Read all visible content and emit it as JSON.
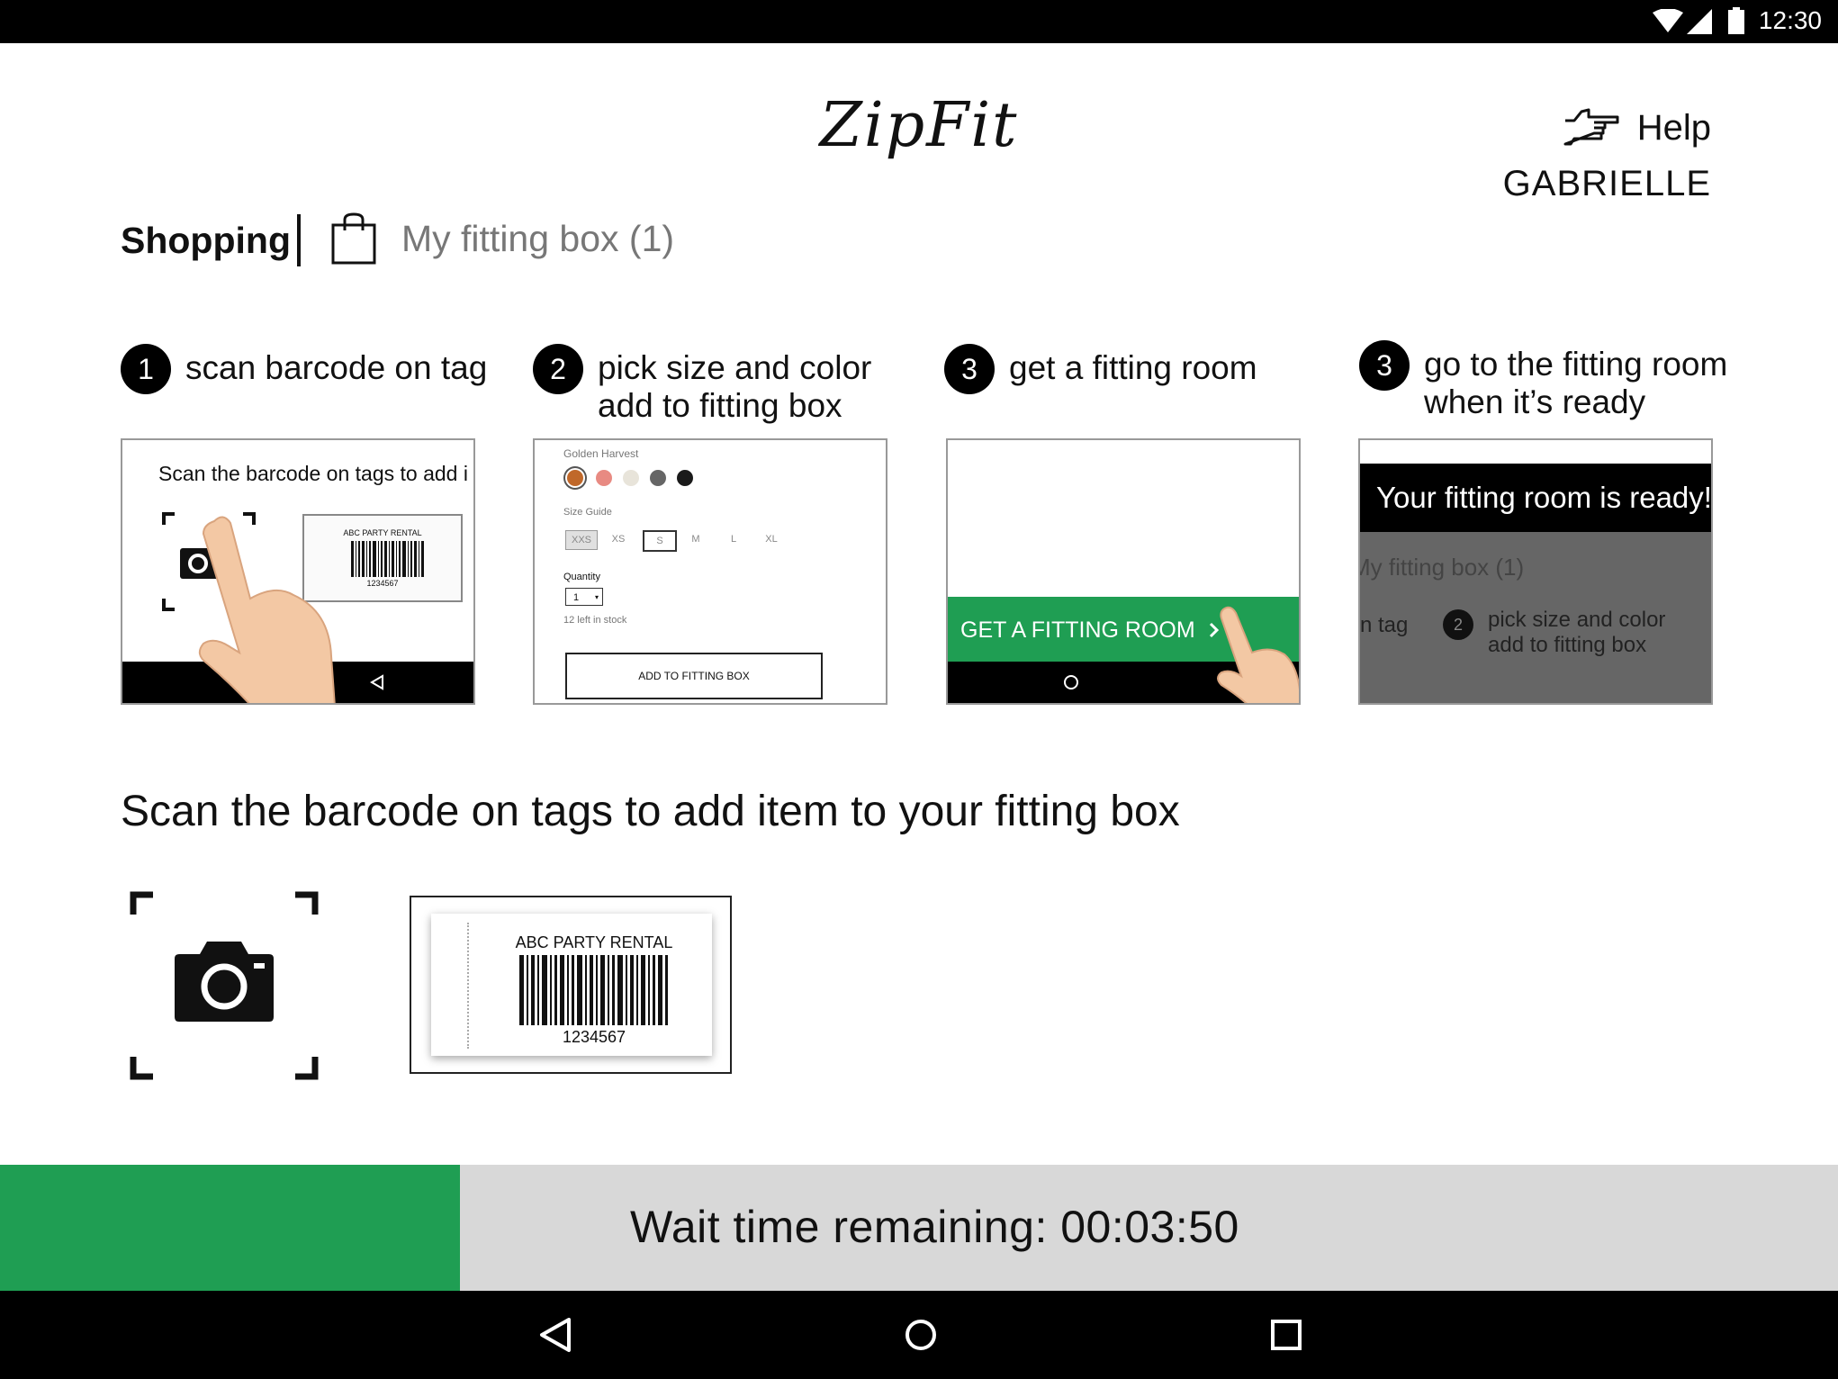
{
  "status_bar": {
    "time": "12:30"
  },
  "header": {
    "logo": "ZipFit",
    "help_label": "Help",
    "user_name": "GABRIELLE"
  },
  "tabs": {
    "shopping": "Shopping",
    "fitting_box": "My fitting box (1)"
  },
  "steps": [
    {
      "number": "1",
      "line1": "scan barcode on tag",
      "line2": ""
    },
    {
      "number": "2",
      "line1": "pick size and color",
      "line2": "add to fitting box"
    },
    {
      "number": "3",
      "line1": "get a fitting room",
      "line2": ""
    },
    {
      "number": "3",
      "line1": "go to the fitting room",
      "line2": "when it’s ready"
    }
  ],
  "card1": {
    "text": "Scan the barcode on tags to add i",
    "tag_brand": "ABC PARTY RENTAL",
    "tag_code": "1234567"
  },
  "card2": {
    "product": "Golden Harvest",
    "colors": [
      "#c0682a",
      "#e88a82",
      "#e8e4da",
      "#666666",
      "#1a1a1a"
    ],
    "size_guide": "Size Guide",
    "sizes": [
      "XXS",
      "XS",
      "S",
      "M",
      "L",
      "XL"
    ],
    "quantity_label": "Quantity",
    "quantity_value": "1",
    "stock": "12 left in stock",
    "add_button": "ADD TO FITTING BOX"
  },
  "card3": {
    "button": "GET A FITTING ROOM"
  },
  "card4": {
    "banner": "Your fitting room is ready!",
    "bg_tab": "My fitting box (1)",
    "bg_step1": "n tag",
    "bg_step2_number": "2",
    "bg_step2_line1": "pick size and color",
    "bg_step2_line2": "add to fitting box"
  },
  "scan": {
    "heading": "Scan the barcode on tags to add item to your fitting box",
    "tag_brand": "ABC PARTY RENTAL",
    "tag_code": "1234567"
  },
  "wait": {
    "label": "Wait time remaining: 00:03:50",
    "progress": 0.25
  },
  "colors": {
    "accent_green": "#1f9e53",
    "wait_bg": "#d8d8d8"
  }
}
